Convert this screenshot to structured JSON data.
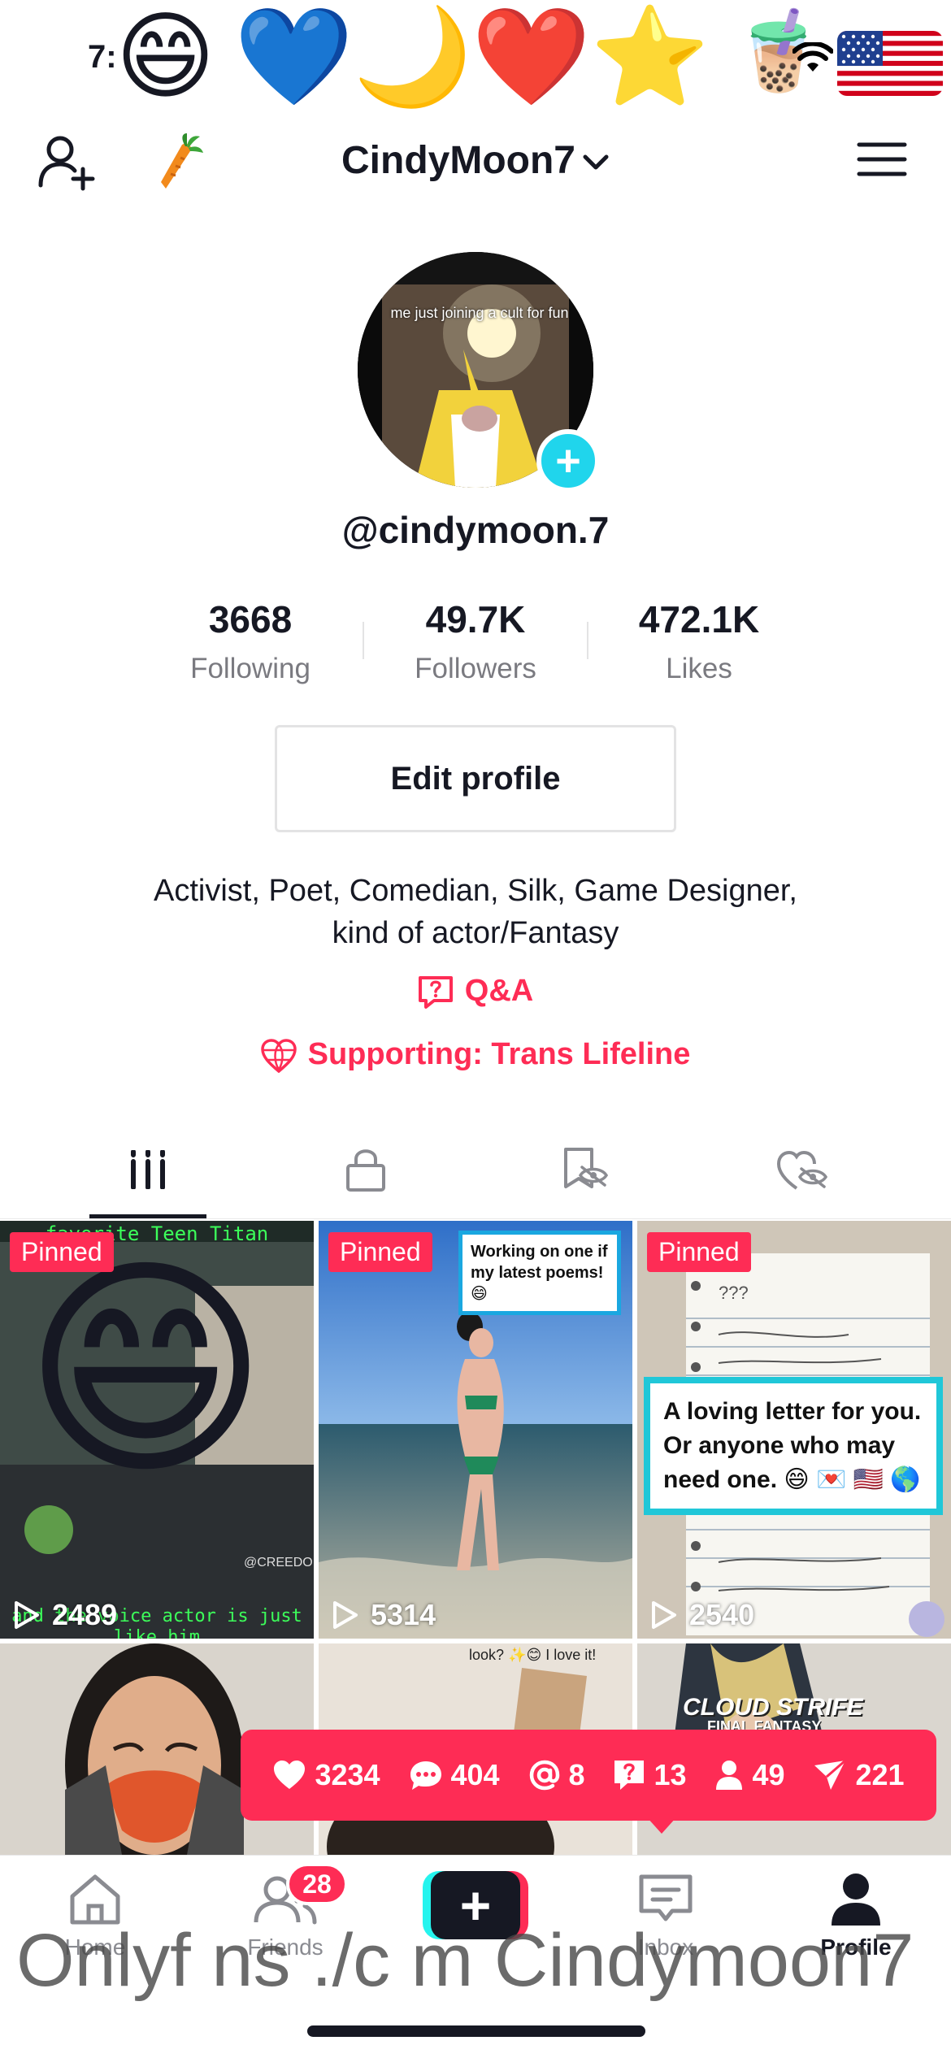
{
  "status_bar": {
    "time": "7:",
    "emojis": [
      "😄",
      "💙",
      "🌙",
      "❤️",
      "⭐",
      "🧋"
    ]
  },
  "header": {
    "username": "CindyMoon7",
    "carrot_emoji": "🥕"
  },
  "profile": {
    "avatar_caption": "me just joining a cult for fun",
    "handle": "@cindymoon.7",
    "stats": [
      {
        "value": "3668",
        "label": "Following"
      },
      {
        "value": "49.7K",
        "label": "Followers"
      },
      {
        "value": "472.1K",
        "label": "Likes"
      }
    ],
    "edit_button": "Edit profile",
    "bio_line1": "Activist, Poet, Comedian, Silk, Game Designer,",
    "bio_line2": "kind of actor/Fantasy",
    "qa_label": "Q&A",
    "supporting_label": "Supporting: Trans Lifeline"
  },
  "tabs": [
    "videos-grid-icon",
    "lock-icon",
    "saved-hidden-icon",
    "liked-hidden-icon"
  ],
  "videos": [
    {
      "pinned": "Pinned",
      "views": "2489",
      "top_text": "favorite Teen Titan",
      "bottom_text": "and the voice actor is just like him",
      "emoji": "😄",
      "credit": "@CREEDOFF"
    },
    {
      "pinned": "Pinned",
      "views": "5314",
      "overlay_text": "Working on one if my latest poems! 😄"
    },
    {
      "pinned": "Pinned",
      "views": "2540",
      "note_text": "???",
      "card_text": "A loving letter for you. Or anyone who may need one. 😄 💌 🇺🇸 🌎"
    },
    {},
    {
      "top_text": "look? ✨😊 I love it!"
    },
    {
      "title_text": "CLOUD STRIFE",
      "subtitle_text": "FINAL FANTASY"
    }
  ],
  "notifications": {
    "likes": "3234",
    "comments": "404",
    "mentions": "8",
    "qa": "13",
    "followers": "49",
    "shares": "221"
  },
  "bottom_nav": {
    "items": [
      {
        "label": "Home"
      },
      {
        "label": "Friends"
      },
      {
        "label": ""
      },
      {
        "label": "Inbox"
      },
      {
        "label": "Profile"
      }
    ],
    "friends_badge": "28"
  },
  "watermark": "Onlyf ns ./c m Cindymoon7",
  "colors": {
    "accent": "#fe2c55",
    "cyan": "#20d5ec",
    "text": "#161823",
    "muted": "#7a7a80"
  }
}
